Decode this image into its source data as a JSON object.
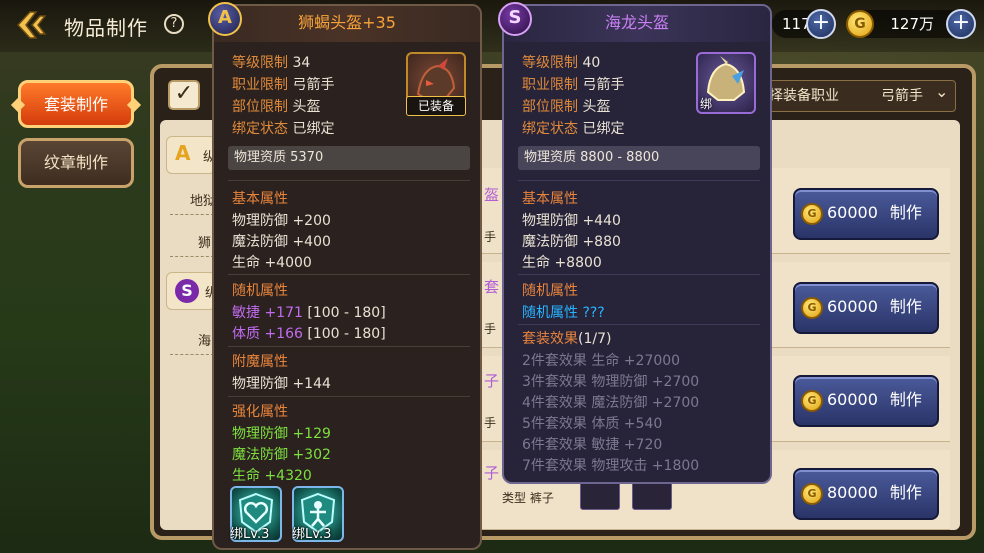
{
  "header": {
    "title": "物品制作",
    "help": "?",
    "stamina": "117",
    "gold": "127万",
    "gold_coin_glyph": "G",
    "plus": "+"
  },
  "sidebar": {
    "tabs": [
      {
        "label": "套装制作",
        "active": true
      },
      {
        "label": "纹章制作",
        "active": false
      }
    ]
  },
  "filter": {
    "checkbox_glyph": "✓",
    "job_label": "择装备职业",
    "job_value": "弓箭手",
    "job_arrow": "⌄"
  },
  "left_list": {
    "grade_a_partial": "纵",
    "grade_s_partial": "纵",
    "items_a": [
      "地狱",
      "狮"
    ],
    "items_s": [
      "海"
    ]
  },
  "rows": [
    {
      "partial_name": "盔",
      "partial_type": "手",
      "price": "60000",
      "make_label": "制作"
    },
    {
      "partial_name": "套",
      "partial_type": "手",
      "price": "60000",
      "make_label": "制作"
    },
    {
      "partial_name": "子",
      "partial_type": "手",
      "price": "60000",
      "make_label": "制作"
    },
    {
      "partial_name": "子",
      "partial_type": "类型 裤子",
      "price": "80000",
      "make_label": "制作"
    }
  ],
  "tooltip_left": {
    "grade": "A",
    "title": "狮蝎头盔+35",
    "level_label": "等级限制",
    "level": "34",
    "job_label": "职业限制",
    "job": "弓箭手",
    "slot_label": "部位限制",
    "slot": "头盔",
    "bind_label": "绑定状态",
    "bind": "已绑定",
    "equipped_badge": "已装备",
    "physical_quality": "物理资质  5370",
    "base_title": "基本属性",
    "base": [
      "物理防御 +200",
      "魔法防御 +400",
      "生命 +4000"
    ],
    "random_title": "随机属性",
    "random": [
      {
        "name": "敏捷",
        "value": "+171",
        "range": "[100 - 180]"
      },
      {
        "name": "体质",
        "value": "+166",
        "range": "[100 - 180]"
      }
    ],
    "enchant_title": "附魔属性",
    "enchant": [
      "物理防御 +144"
    ],
    "enhance_title": "强化属性",
    "enhance": [
      {
        "name": "物理防御",
        "value": "+129"
      },
      {
        "name": "魔法防御",
        "value": "+302"
      },
      {
        "name": "生命",
        "value": "+4320"
      }
    ],
    "gems": [
      {
        "bind": "绑",
        "level": "Lv.3",
        "icon": "heart-shield-icon"
      },
      {
        "bind": "绑",
        "level": "Lv.3",
        "icon": "figure-shield-icon"
      }
    ]
  },
  "tooltip_right": {
    "grade": "S",
    "title": "海龙头盔",
    "level_label": "等级限制",
    "level": "40",
    "job_label": "职业限制",
    "job": "弓箭手",
    "slot_label": "部位限制",
    "slot": "头盔",
    "bind_label": "绑定状态",
    "bind": "已绑定",
    "bind_badge": "绑",
    "physical_quality": "物理资质  8800 - 8800",
    "base_title": "基本属性",
    "base": [
      "物理防御 +440",
      "魔法防御 +880",
      "生命 +8800"
    ],
    "random_title": "随机属性",
    "random_unknown": "随机属性 ???",
    "set_title": "套装效果",
    "set_count": "(1/7)",
    "set": [
      "2件套效果  生命 +27000",
      "3件套效果  物理防御 +2700",
      "4件套效果  魔法防御 +2700",
      "5件套效果  体质 +540",
      "6件套效果  敏捷 +720",
      "7件套效果  物理攻击 +1800"
    ]
  },
  "colors": {
    "orange_title": "#f7a33a",
    "purple_title": "#c980f4",
    "green_value": "#7de03e",
    "blue_value": "#27b4ff",
    "purple_value": "#c16bf0"
  }
}
